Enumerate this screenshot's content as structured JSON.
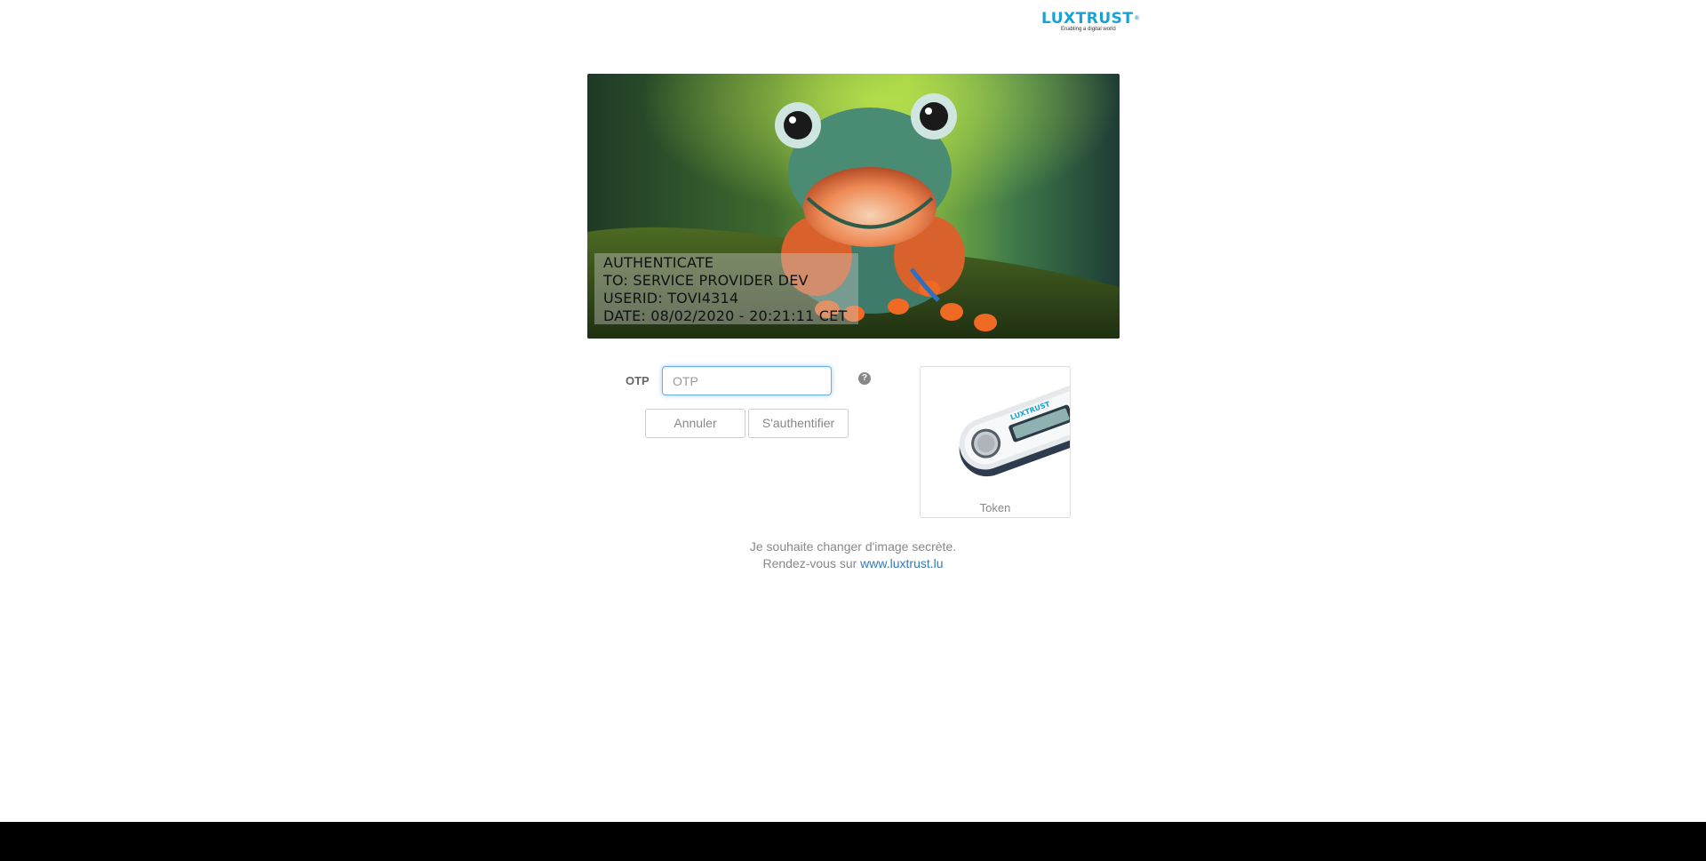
{
  "logo": {
    "brand": "LUXTRUST",
    "trademark": "®",
    "tagline": "Enabling a digital world",
    "color": "#1aa2d6"
  },
  "secret_image": {
    "subject": "smiling green frog on mossy log",
    "lines": [
      "AUTHENTICATE",
      "TO: SERVICE PROVIDER DEV",
      "USERID: TOVI4314",
      "DATE: 08/02/2020 - 20:21:11 CET"
    ]
  },
  "form": {
    "otp_label": "OTP",
    "otp_placeholder": "OTP",
    "otp_value": "",
    "help_icon": "question-circle-icon",
    "cancel_label": "Annuler",
    "submit_label": "S'authentifier"
  },
  "token": {
    "label": "Token",
    "device_brand": "LUXTRUST"
  },
  "footer": {
    "change_text": "Je souhaite changer d'image secrète.",
    "visit_prefix": "Rendez-vous sur ",
    "visit_link": "www.luxtrust.lu"
  },
  "colors": {
    "accent": "#1aa2d6",
    "link": "#337ab7",
    "focus": "#66afe9"
  }
}
